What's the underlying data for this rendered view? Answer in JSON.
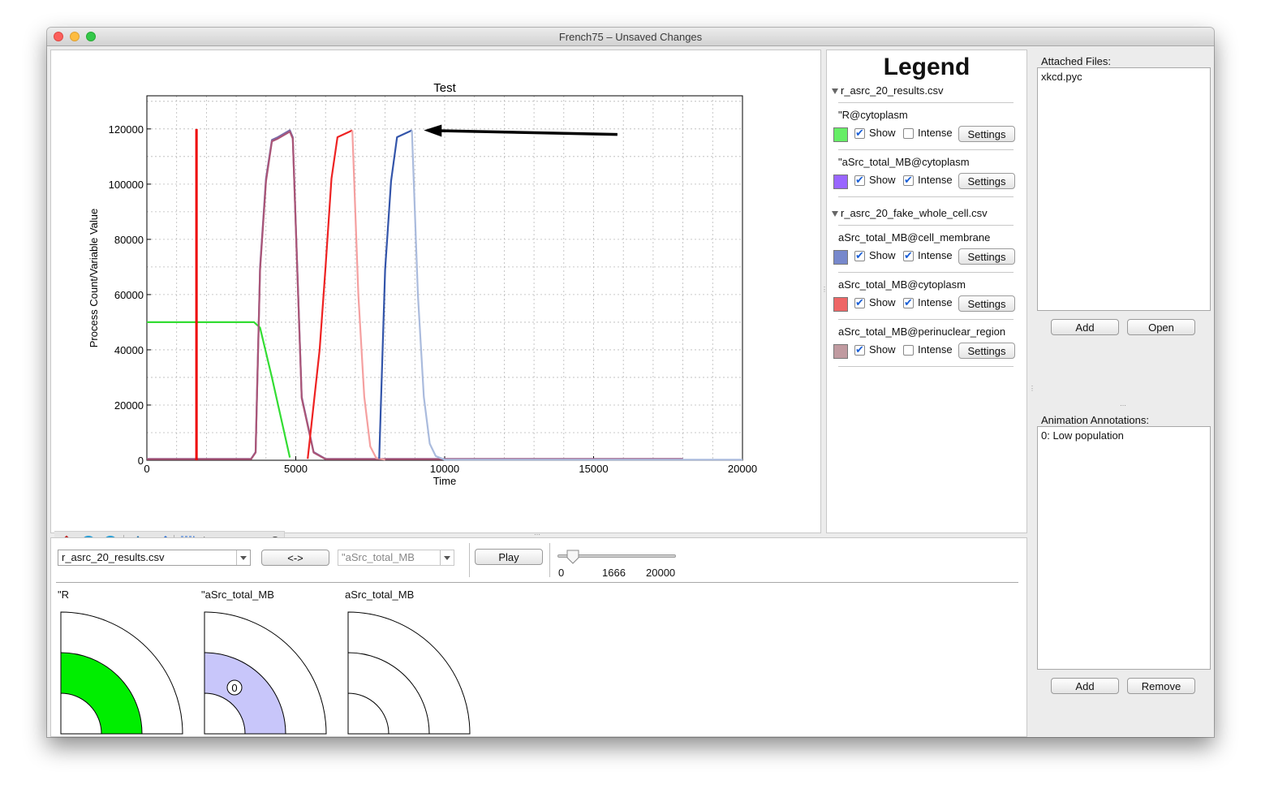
{
  "window": {
    "title": "French75 – Unsaved Changes"
  },
  "plot": {
    "chart_data": {
      "type": "line",
      "title": "Test",
      "xlabel": "Time",
      "ylabel": "Process Count/Variable Value",
      "xlim": [
        0,
        20000
      ],
      "ylim": [
        0,
        132000
      ],
      "xticks": [
        "0",
        "5000",
        "10000",
        "15000",
        "20000"
      ],
      "yticks": [
        "0",
        "20000",
        "40000",
        "60000",
        "80000",
        "100000",
        "120000"
      ],
      "grid": true,
      "marker_line": {
        "x": 1666,
        "color": "#ee0000"
      },
      "annotation": {
        "type": "arrow",
        "from": [
          15800,
          118000
        ],
        "to": [
          9300,
          119500
        ],
        "color": "#000000"
      },
      "series": [
        {
          "color": "#33dd33",
          "x": [
            0,
            3400,
            3600,
            3800,
            4200,
            4800
          ],
          "y": [
            50000,
            50000,
            50000,
            48000,
            30000,
            1000
          ]
        },
        {
          "color": "#7a6aa8",
          "x": [
            0,
            3500,
            3650,
            3800,
            4000,
            4200,
            4400,
            4800,
            4900,
            5200,
            5600,
            6000,
            18000
          ],
          "y": [
            500,
            500,
            3000,
            70000,
            102000,
            116000,
            117000,
            119500,
            117000,
            23000,
            3000,
            500,
            500
          ]
        },
        {
          "color": "#aa5577",
          "x": [
            0,
            3500,
            3650,
            3800,
            4000,
            4200,
            4400,
            4800,
            4900,
            5200,
            5600,
            6000,
            18000
          ],
          "y": [
            400,
            400,
            2800,
            69000,
            101000,
            115500,
            116500,
            119000,
            116500,
            22500,
            2800,
            400,
            400
          ]
        },
        {
          "color": "#ee2222",
          "x": [
            5400,
            5800,
            6000,
            6200,
            6400,
            6800,
            6900
          ],
          "y": [
            500,
            40000,
            70000,
            102000,
            117000,
            119000,
            119500
          ]
        },
        {
          "color": "#f5a0a0",
          "x": [
            6900,
            7100,
            7300,
            7500,
            7700,
            8000
          ],
          "y": [
            119500,
            60000,
            23000,
            5000,
            800,
            200
          ]
        },
        {
          "color": "#3355aa",
          "x": [
            7800,
            8000,
            8200,
            8400,
            8600,
            8800,
            8900
          ],
          "y": [
            500,
            69000,
            101000,
            117000,
            118000,
            119000,
            119500
          ]
        },
        {
          "color": "#aabbdd",
          "x": [
            8900,
            9100,
            9300,
            9500,
            9700,
            10000,
            20000
          ],
          "y": [
            119500,
            60000,
            23000,
            6000,
            1500,
            200,
            200
          ]
        }
      ]
    }
  },
  "legend": {
    "title": "Legend",
    "files": [
      {
        "name": "r_asrc_20_results.csv",
        "series": [
          {
            "name": "\"R@cytoplasm",
            "color": "#66ee66",
            "show": true,
            "intense": false
          },
          {
            "name": "\"aSrc_total_MB@cytoplasm",
            "color": "#9966ff",
            "show": true,
            "intense": true
          }
        ]
      },
      {
        "name": "r_asrc_20_fake_whole_cell.csv",
        "series": [
          {
            "name": "aSrc_total_MB@cell_membrane",
            "color": "#7788cc",
            "show": true,
            "intense": true
          },
          {
            "name": "aSrc_total_MB@cytoplasm",
            "color": "#ee6666",
            "show": true,
            "intense": true
          },
          {
            "name": "aSrc_total_MB@perinuclear_region",
            "color": "#c09aa0",
            "show": true,
            "intense": false
          }
        ]
      }
    ],
    "show_label": "Show",
    "intense_label": "Intense",
    "settings_label": "Settings"
  },
  "attached": {
    "label": "Attached Files:",
    "items": [
      "xkcd.pyc"
    ],
    "add_label": "Add",
    "open_label": "Open"
  },
  "annotations": {
    "label": "Animation Annotations:",
    "items": [
      "0: Low population"
    ],
    "add_label": "Add",
    "remove_label": "Remove"
  },
  "controls": {
    "file_select": "r_asrc_20_results.csv",
    "swap_label": "<->",
    "variable_select": "\"aSrc_total_MB",
    "play_label": "Play",
    "slider_min": "0",
    "slider_value": "1666",
    "slider_max": "20000",
    "slider_fraction": 0.0833
  },
  "quadrants": [
    {
      "label": "\"R",
      "fill": "#00ee00",
      "badge": ""
    },
    {
      "label": "\"aSrc_total_MB",
      "fill": "#c8c6fa",
      "badge": "0"
    },
    {
      "label": "aSrc_total_MB",
      "fill": "#ffffff",
      "badge": ""
    }
  ]
}
